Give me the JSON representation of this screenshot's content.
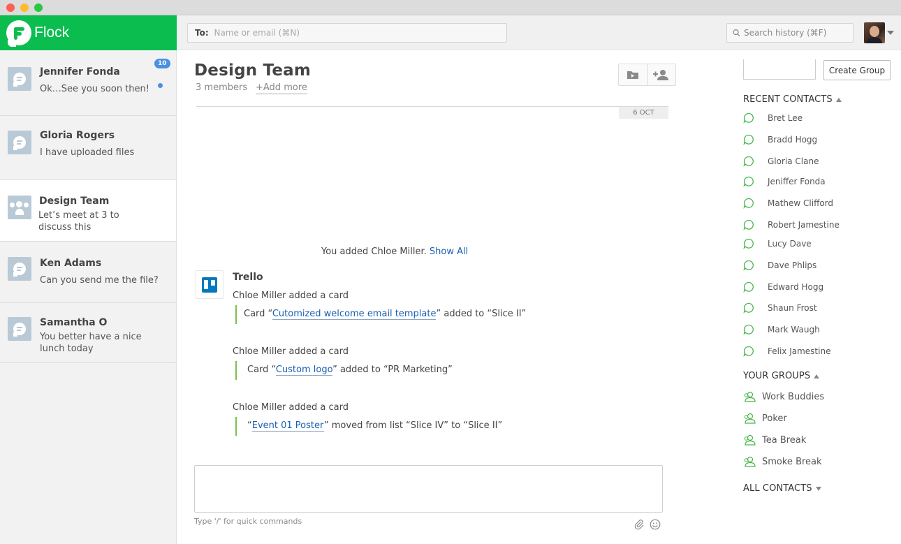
{
  "app": {
    "name": "Flock"
  },
  "topbar": {
    "to_label": "To:",
    "to_placeholder": "Name or email (⌘N)",
    "search_placeholder": "Search history (⌘F)"
  },
  "conversations": [
    {
      "name": "Jennifer Fonda",
      "preview": "Ok…See you soon then!",
      "badge": "10",
      "unread": true,
      "type": "person"
    },
    {
      "name": "Gloria Rogers",
      "preview": "I have uploaded files",
      "type": "person"
    },
    {
      "name": "Design Team",
      "preview": "Let’s meet at 3 to discuss this",
      "type": "group",
      "active": true
    },
    {
      "name": "Ken Adams",
      "preview": "Can you send me the file?",
      "type": "person"
    },
    {
      "name": "Samantha O",
      "preview": "You better have a nice lunch today",
      "type": "person"
    }
  ],
  "chat": {
    "title": "Design Team",
    "members": "3 members",
    "add_more": "+Add more",
    "date": "6 OCT",
    "system_message": "You added Chloe Miller.",
    "show_all": "Show All",
    "sender": "Trello",
    "events": [
      {
        "text": "Chloe Miller added a card",
        "prefix": "Card “",
        "link": "Cutomized welcome email template",
        "suffix": "” added to “Slice II”"
      },
      {
        "text": "Chloe Miller added a card",
        "prefix": "Card “",
        "link": "Custom logo",
        "suffix": "” added to “PR Marketing”"
      },
      {
        "text": "Chloe Miller added a card",
        "prefix": "“",
        "link": "Event 01 Poster",
        "suffix": "” moved from list “Slice IV” to “Slice II”"
      }
    ],
    "composer_hint": "Type '/' for quick commands"
  },
  "right_panel": {
    "create_group": "Create Group",
    "recent_title": "RECENT CONTACTS",
    "recent_contacts": [
      "Bret Lee",
      "Bradd Hogg",
      "Gloria Clane",
      "Jeniffer Fonda",
      "Mathew Clifford",
      "Robert Jamestine",
      "Lucy Dave",
      "Dave Phlips",
      "Edward Hogg",
      "Shaun Frost",
      "Mark Waugh",
      "Felix Jamestine"
    ],
    "groups_title": "YOUR GROUPS",
    "groups": [
      "Work Buddies",
      "Poker",
      "Tea Break",
      "Smoke Break"
    ],
    "all_contacts_title": "ALL CONTACTS"
  },
  "colors": {
    "brand": "#0bbd4f",
    "link": "#1b5fb0",
    "badge": "#4a90e2",
    "quote_bar": "#7cc04a",
    "contact_icon": "#47b649"
  },
  "icons": [
    "search-icon",
    "chat-bubble-icon",
    "group-icon",
    "files-icon",
    "add-member-icon",
    "trello-icon",
    "attach-icon",
    "emoji-icon",
    "contact-bubble-icon",
    "group-people-icon"
  ]
}
